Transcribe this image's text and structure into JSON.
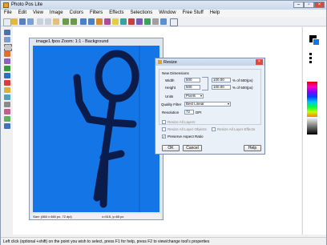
{
  "app": {
    "title": "Photo Pos Lite"
  },
  "menu": [
    "File",
    "Edit",
    "View",
    "Image",
    "Colors",
    "Filters",
    "Effects",
    "Selections",
    "Window",
    "Free Stuff",
    "Help"
  ],
  "image_window": {
    "title": "image1.fpos  Zoom: 1:1 - Background",
    "status_left": "Size: (660 x 660 px, 72 dpi)",
    "status_right": "x=515, y=65 px"
  },
  "dialog": {
    "title": "Resize",
    "group_label": "New Dimensions",
    "width_label": "Width",
    "width_value": "500",
    "width_percent": "100.00",
    "width_percent_label": "% of 500(px)",
    "height_label": "Height",
    "height_value": "500",
    "height_percent": "100.00",
    "height_percent_label": "% of 500(px)",
    "units_label": "Units",
    "units_value": "Pixels",
    "quality_label": "Quality Filter",
    "quality_value": "Best Linear",
    "resolution_label": "Resolution",
    "resolution_value": "72",
    "resolution_unit": "DPI",
    "resize_all_layers": "Resize All Layers",
    "resize_all_objects": "Resize All Layer Objects",
    "resize_all_effects": "Resize All Layer Effects",
    "preserve_aspect": "Preserve Aspect Ratio",
    "ok": "OK",
    "cancel": "Cancel",
    "help": "Help"
  },
  "status": "Left click (optional +shift) on the point you wish to select, press F1 for help, press F2 to view/change tool's properties",
  "colors": {
    "canvas": "#1476e6",
    "stroke": "#0b1b4a"
  }
}
